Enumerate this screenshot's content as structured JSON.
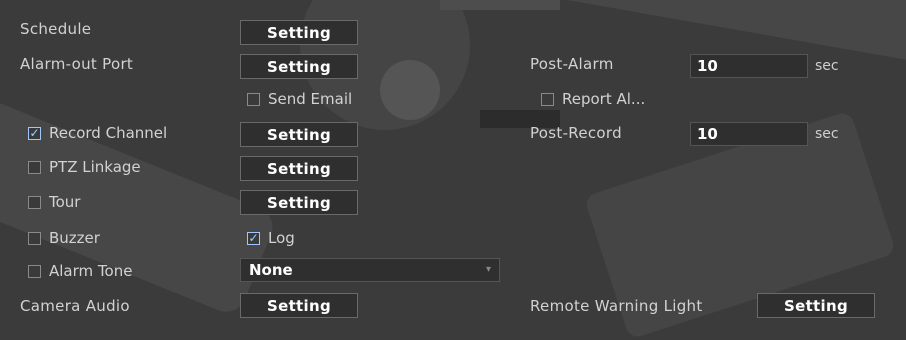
{
  "rows": {
    "schedule": {
      "label": "Schedule",
      "button": "Setting"
    },
    "alarm_out_port": {
      "label": "Alarm-out Port",
      "button": "Setting"
    },
    "send_email": {
      "label": "Send Email",
      "checked": false
    },
    "record_channel": {
      "label": "Record Channel",
      "checked": true,
      "button": "Setting"
    },
    "ptz_linkage": {
      "label": "PTZ Linkage",
      "checked": false,
      "button": "Setting"
    },
    "tour": {
      "label": "Tour",
      "checked": false,
      "button": "Setting"
    },
    "buzzer": {
      "label": "Buzzer",
      "checked": false
    },
    "log": {
      "label": "Log",
      "checked": true
    },
    "alarm_tone": {
      "label": "Alarm Tone",
      "checked": false,
      "value": "None"
    },
    "camera_audio": {
      "label": "Camera Audio",
      "button": "Setting"
    }
  },
  "right": {
    "post_alarm": {
      "label": "Post-Alarm",
      "value": "10",
      "unit": "sec"
    },
    "report_alarm": {
      "label": "Report Al...",
      "checked": false
    },
    "post_record": {
      "label": "Post-Record",
      "value": "10",
      "unit": "sec"
    },
    "remote_warning_light": {
      "label": "Remote Warning Light",
      "button": "Setting"
    }
  },
  "icons": {
    "check": "✓",
    "dropdown": "▾"
  }
}
